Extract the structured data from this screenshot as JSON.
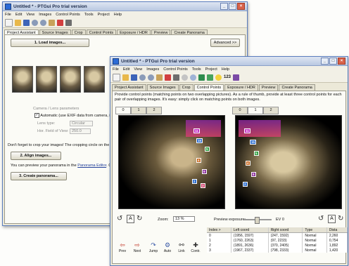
{
  "back_window": {
    "title": "Untitled * - PTGui Pro trial version",
    "menu": [
      "File",
      "Edit",
      "View",
      "Images",
      "Control Points",
      "Tools",
      "Project",
      "Help"
    ],
    "tabs": [
      "Project Assistant",
      "Source Images",
      "Crop",
      "Control Points",
      "Exposure / HDR",
      "Preview",
      "Create Panorama"
    ],
    "load_button": "1. Load images...",
    "advanced_button": "Advanced >>",
    "camera_header": "Camera / Lens parameters",
    "auto_exif": "Automatic (use EXIF data from camera, if",
    "lens_type_label": "Lens type:",
    "lens_type_value": "Circular",
    "hfov_label": "Hor. Field of View:",
    "hfov_value": "250.0",
    "crop_hint": "Don't forget to crop your images! The cropping circle on the",
    "align_button": "2. Align images...",
    "preview_hint_pre": "You can preview your panorama in the",
    "preview_link": "Panorama Editor",
    "preview_hint_post": ". Or",
    "create_button": "3. Create panorama..."
  },
  "front_window": {
    "title": "Untitled * - PTGui Pro trial version",
    "menu": [
      "File",
      "Edit",
      "View",
      "Images",
      "Control Points",
      "Tools",
      "Project",
      "Help"
    ],
    "toolbar_number": "123",
    "tabs": [
      "Project Assistant",
      "Source Images",
      "Crop",
      "Control Points",
      "Exposure / HDR",
      "Preview",
      "Create Panorama"
    ],
    "instructions": "Provide control points (matching points on two overlapping pictures). As a rule of thumb, provide at least three control points for each pair of overlapping images. It's easy: simply click on matching points on both images.",
    "left_tabs": [
      "0",
      "1",
      "2"
    ],
    "right_tabs": [
      "0",
      "1",
      "2"
    ],
    "zoom_label": "Zoom:",
    "zoom_value": "13 %",
    "preview_exposure_label": "Preview exposure:",
    "preview_exposure_value": "0.45",
    "ev_label": "EV 0",
    "nav_buttons": [
      {
        "label": "Prev",
        "icon": "prev-arrow-icon"
      },
      {
        "label": "Next",
        "icon": "next-arrow-icon"
      },
      {
        "label": "Jump",
        "icon": "jump-icon"
      },
      {
        "label": "Auto",
        "icon": "auto-icon"
      },
      {
        "label": "Link",
        "icon": "link-icon"
      },
      {
        "label": "Contr.",
        "icon": "control-icon"
      }
    ],
    "table": {
      "headers": [
        "Index >",
        "Left coord",
        "Right coord",
        "Type",
        "Dista"
      ],
      "rows": [
        [
          "0",
          "(1956, 1597)",
          "(247, 1592)",
          "Normal",
          "2,260"
        ],
        [
          "1",
          "(1760, 2263)",
          "(97, 2233)",
          "Normal",
          "0,754"
        ],
        [
          "2",
          "(1891, 2636)",
          "(370, 2405)",
          "Normal",
          "1,892"
        ],
        [
          "3",
          "(1967, 2337)",
          "(798, 2333)",
          "Normal",
          "1,420"
        ]
      ]
    }
  }
}
